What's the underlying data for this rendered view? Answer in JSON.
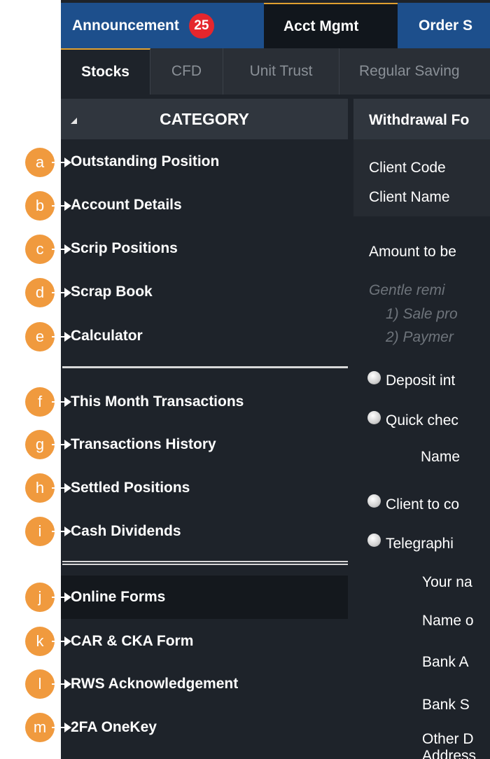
{
  "top_tabs": {
    "announcement": "Announcement",
    "announcement_count": "25",
    "acct_mgmt": "Acct Mgmt",
    "order": "Order S"
  },
  "sub_tabs": {
    "stocks": "Stocks",
    "cfd": "CFD",
    "unit_trust": "Unit Trust",
    "regular_savings": "Regular Saving"
  },
  "sidebar": {
    "category_title": "CATEGORY",
    "items": [
      {
        "label": "Outstanding Position",
        "marker": "a"
      },
      {
        "label": "Account Details",
        "marker": "b"
      },
      {
        "label": "Scrip Positions",
        "marker": "c"
      },
      {
        "label": "Scrap Book",
        "marker": "d"
      },
      {
        "label": "Calculator",
        "marker": "e"
      },
      {
        "label": "This Month Transactions",
        "marker": "f"
      },
      {
        "label": "Transactions History",
        "marker": "g"
      },
      {
        "label": "Settled Positions",
        "marker": "h"
      },
      {
        "label": "Cash Dividends",
        "marker": "i"
      },
      {
        "label": "Online Forms",
        "marker": "j"
      },
      {
        "label": "CAR & CKA Form",
        "marker": "k"
      },
      {
        "label": "RWS Acknowledgement",
        "marker": "l"
      },
      {
        "label": "2FA OneKey",
        "marker": "m"
      }
    ]
  },
  "content": {
    "header": "Withdrawal Fo",
    "client_code_label": "Client Code",
    "client_name_label": "Client Name",
    "amount_label": "Amount to be",
    "reminder_title": "Gentle remi",
    "reminder_1": "1) Sale pro",
    "reminder_2": "2) Paymer",
    "option_deposit": "Deposit int",
    "option_quick_cheque": "Quick chec",
    "name_label": "Name",
    "option_client": "Client to co",
    "option_telegraphic": "Telegraphi",
    "your_name_label": "Your na",
    "name_of_label": "Name o",
    "bank_a_label": "Bank A",
    "bank_s_label": "Bank S",
    "other_d_label": "Other D",
    "address_label": "Address"
  },
  "colors": {
    "panel_bg": "#1e232a",
    "tab_blue": "#1d4f8c",
    "accent_gold": "#e0a030",
    "badge_red": "#e5262d",
    "marker_orange": "#f09a3e"
  }
}
